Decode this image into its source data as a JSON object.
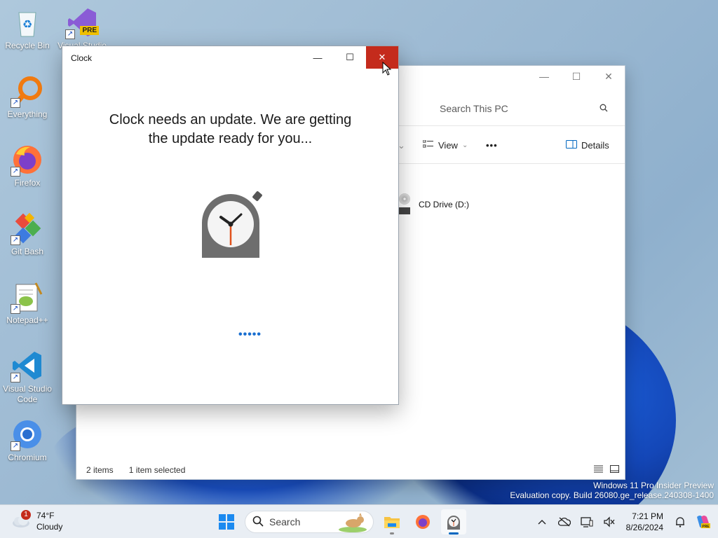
{
  "desktop": {
    "icons": [
      {
        "label": "Recycle Bin"
      },
      {
        "label": "Visual Studio 2022"
      },
      {
        "label": "Everything"
      },
      {
        "label": "Firefox"
      },
      {
        "label": "Git Bash"
      },
      {
        "label": "Notepad++"
      },
      {
        "label": "Visual Studio Code"
      },
      {
        "label": "Chromium"
      }
    ],
    "pre_badge": "PRE",
    "shortcut_arrow": "↗"
  },
  "explorer": {
    "search_placeholder": "Search This PC",
    "view_label": "View",
    "more_label": "•••",
    "details_label": "Details",
    "drive_label": "CD Drive (D:)",
    "status_items": "2 items",
    "status_selected": "1 item selected"
  },
  "clock_window": {
    "title": "Clock",
    "message_line1": "Clock needs an update. We are getting",
    "message_line2": "the update ready for you...",
    "progress_dots": "•••••",
    "minimize_glyph": "—",
    "maximize_glyph": "☐",
    "close_glyph": "✕"
  },
  "watermark": {
    "line1": "Windows 11 Pro Insider Preview",
    "line2": "Evaluation copy. Build 26080.ge_release.240308-1400"
  },
  "taskbar": {
    "weather_badge": "1",
    "temperature": "74°F",
    "condition": "Cloudy",
    "search_label": "Search",
    "time": "7:21 PM",
    "date": "8/26/2024"
  },
  "colors": {
    "close_red": "#c42b1c",
    "accent_blue": "#0067c0"
  }
}
